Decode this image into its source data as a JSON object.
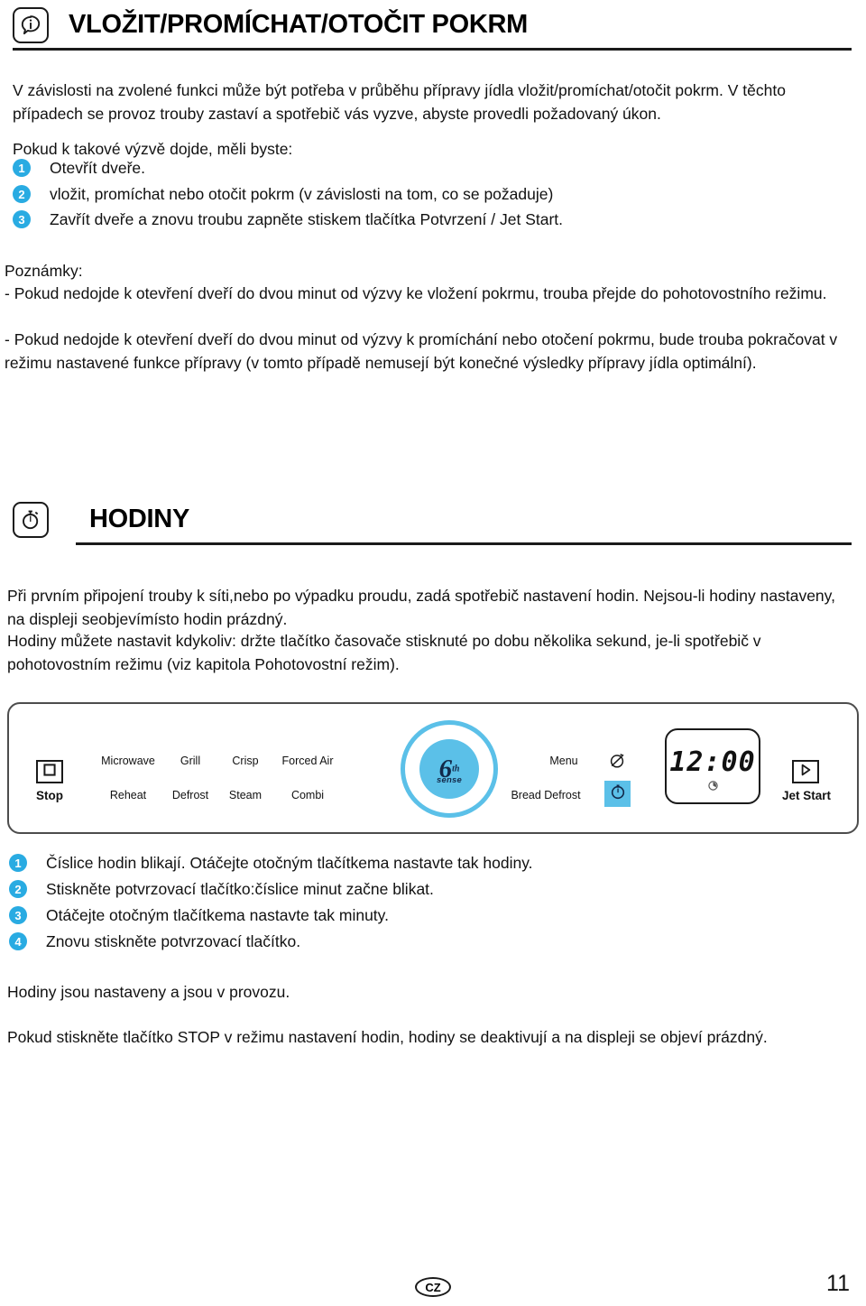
{
  "sections": {
    "insert_stir_turn": {
      "icon": "info-bubble-icon",
      "title": "VLOŽIT/PROMÍCHAT/OTOČIT POKRM",
      "intro": "V závislosti na zvolené funkci může být potřeba v průběhu přípravy jídla vložit/promíchat/otočit pokrm. V těchto případech se provoz trouby zastaví a spotřebič vás vyzve, abyste provedli požadovaný úkon.",
      "intro2": "Pokud k takové výzvě dojde, měli byste:",
      "steps": [
        {
          "num": "1",
          "text": "Otevřít dveře."
        },
        {
          "num": "2",
          "text": "vložit, promíchat nebo otočit pokrm (v závislosti na tom, co se požaduje)"
        },
        {
          "num": "3",
          "text": "Zavřít dveře a znovu troubu zapněte stiskem tlačítka Potvrzení / Jet Start."
        }
      ],
      "notes_label": "Poznámky:",
      "note1": "- Pokud nedojde k otevření dveří do dvou minut od výzvy ke vložení pokrmu, trouba přejde do pohotovostního režimu.",
      "note2": "- Pokud nedojde k otevření dveří do dvou minut od výzvy k promíchání nebo otočení pokrmu, bude trouba pokračovat v režimu nastavené funkce přípravy (v tomto případě nemusejí být konečné výsledky přípravy jídla optimální)."
    },
    "clock": {
      "icon": "stopwatch-icon",
      "title": "HODINY",
      "para1": "Při prvním připojení trouby k síti,nebo po výpadku proudu, zadá spotřebič nastavení hodin. Nejsou-li hodiny nastaveny, na displeji seobjevímísto hodin prázdný.",
      "para2": "Hodiny můžete nastavit kdykoliv: držte tlačítko časovače stisknuté po dobu několika sekund, je-li spotřebič v pohotovostním režimu (viz kapitola Pohotovostní režim).",
      "steps": [
        {
          "num": "1",
          "text": "Číslice hodin blikají. Otáčejte otočným tlačítkema nastavte tak hodiny."
        },
        {
          "num": "2",
          "text": "Stiskněte potvrzovací tlačítko:číslice minut začne blikat."
        },
        {
          "num": "3",
          "text": "Otáčejte otočným tlačítkema nastavte tak minuty."
        },
        {
          "num": "4",
          "text": "Znovu stiskněte potvrzovací tlačítko."
        }
      ],
      "closing1": "Hodiny jsou nastaveny a jsou v provozu.",
      "closing2": "Pokud stiskněte tlačítko STOP v režimu nastavení hodin, hodiny se deaktivují a na displeji se objeví prázdný."
    }
  },
  "control_panel": {
    "stop_label": "Stop",
    "stop_icon": "square-stop-icon",
    "functions_row1": [
      "Microwave",
      "Grill",
      "Crisp",
      "Forced Air"
    ],
    "functions_row2": [
      "Reheat",
      "Defrost",
      "Steam",
      "Combi"
    ],
    "knob": {
      "six": "6",
      "th": "th",
      "sense": "sense"
    },
    "menu_label": "Menu",
    "menu_icon": "crossed-circle-icon",
    "bread_defrost_label": "Bread Defrost",
    "bread_defrost_icon": "timer-icon",
    "display_time": "12:00",
    "display_icon": "clock-indicator-icon",
    "jet_start_label": "Jet Start",
    "jet_start_icon": "play-triangle-icon",
    "accent_blue": "#5BC0E8"
  },
  "footer": {
    "locale": "CZ",
    "page_number": "11"
  }
}
